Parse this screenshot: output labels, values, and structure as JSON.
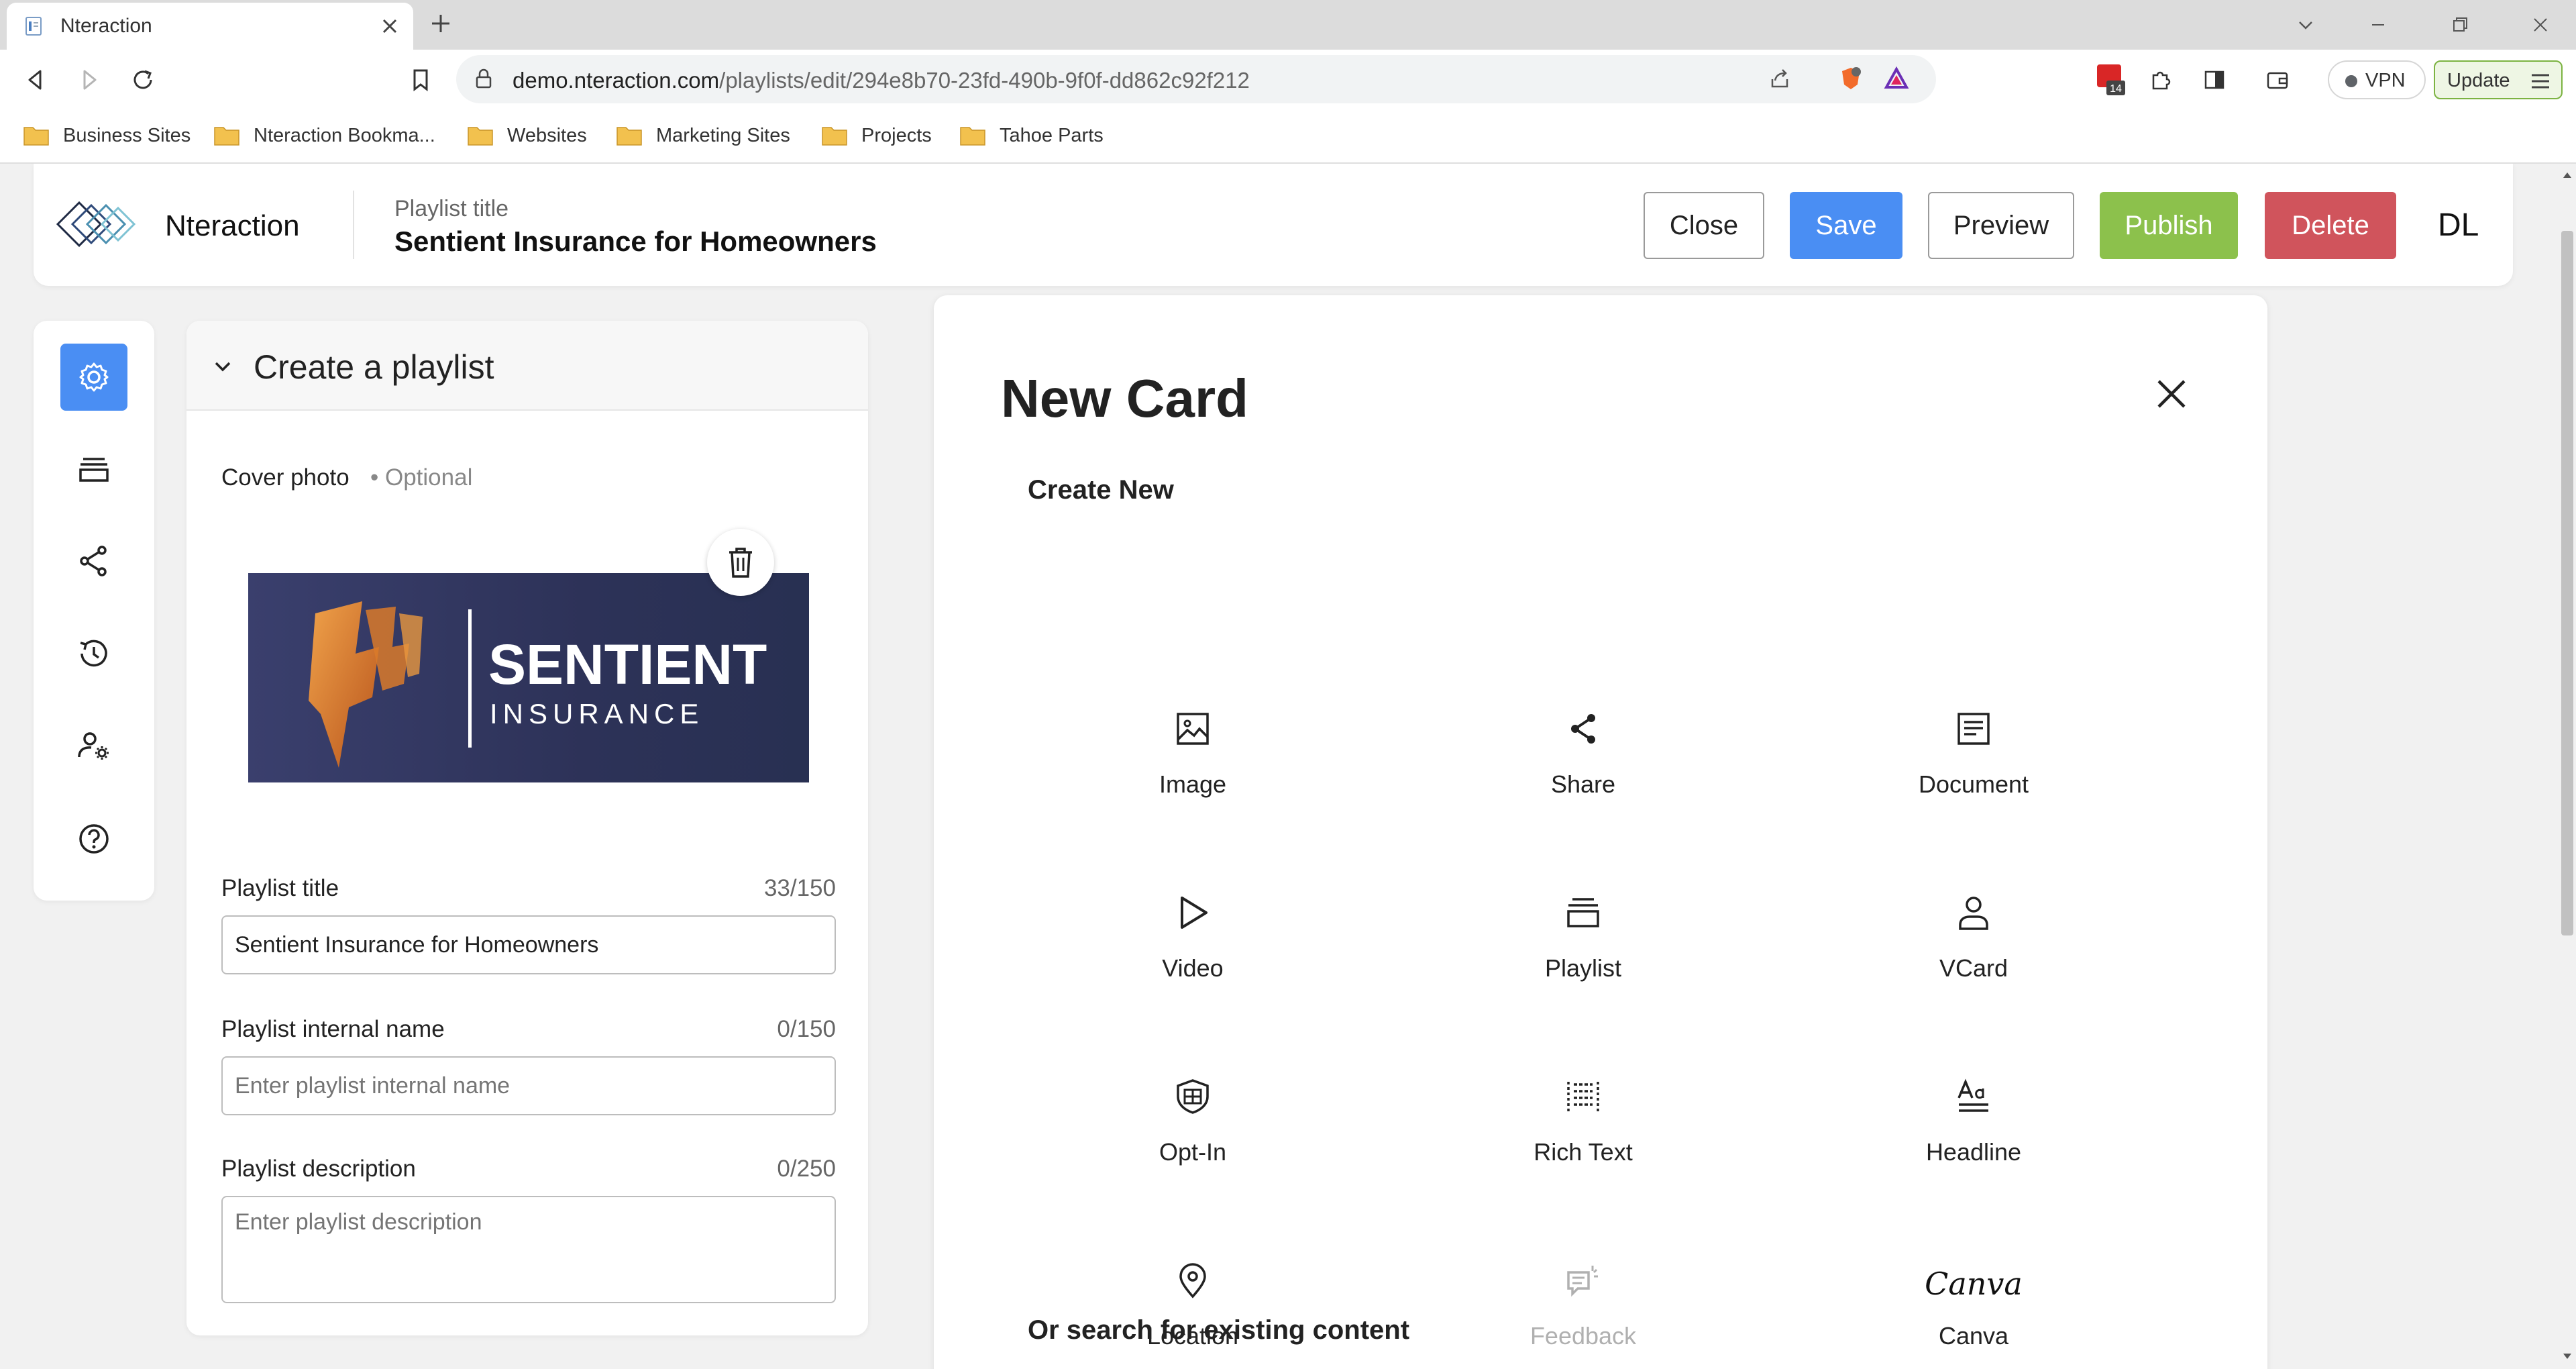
{
  "browser": {
    "tab_title": "Nteraction",
    "url_host": "demo.nteraction.com",
    "url_path": "/playlists/edit/294e8b70-23fd-490b-9f0f-dd862c92f212",
    "extension_badge": "14",
    "vpn_label": "VPN",
    "update_label": "Update",
    "bookmarks": [
      "Business Sites",
      "Nteraction Bookma...",
      "Websites",
      "Marketing Sites",
      "Projects",
      "Tahoe Parts"
    ]
  },
  "header": {
    "brand": "Nteraction",
    "title_label": "Playlist title",
    "title": "Sentient Insurance for Homeowners",
    "buttons": {
      "close": "Close",
      "save": "Save",
      "preview": "Preview",
      "publish": "Publish",
      "delete": "Delete"
    },
    "user_initials": "DL"
  },
  "rail": {
    "items": [
      "settings",
      "playlist",
      "share",
      "history",
      "user-settings",
      "help"
    ]
  },
  "panel": {
    "title": "Create a playlist",
    "cover_label": "Cover photo",
    "cover_optional": "• Optional",
    "cover_brand_name": "SENTIENT",
    "cover_brand_sub": "INSURANCE",
    "fields": {
      "title": {
        "label": "Playlist title",
        "count": "33/150",
        "value": "Sentient Insurance for Homeowners"
      },
      "internal_name": {
        "label": "Playlist internal name",
        "count": "0/150",
        "placeholder": "Enter playlist internal name"
      },
      "description": {
        "label": "Playlist description",
        "count": "0/250",
        "placeholder": "Enter playlist description"
      }
    }
  },
  "modal": {
    "title": "New Card",
    "create_new": "Create New",
    "options": [
      {
        "label": "Image",
        "icon": "image-icon"
      },
      {
        "label": "Share",
        "icon": "share-icon"
      },
      {
        "label": "Document",
        "icon": "document-icon"
      },
      {
        "label": "Video",
        "icon": "play-icon"
      },
      {
        "label": "Playlist",
        "icon": "playlist-icon"
      },
      {
        "label": "VCard",
        "icon": "person-icon"
      },
      {
        "label": "Opt-In",
        "icon": "opt-in-icon"
      },
      {
        "label": "Rich Text",
        "icon": "rich-text-icon"
      },
      {
        "label": "Headline",
        "icon": "headline-icon"
      },
      {
        "label": "Location",
        "icon": "location-pin-icon"
      },
      {
        "label": "Feedback",
        "icon": "feedback-icon",
        "disabled": true
      },
      {
        "label": "Canva",
        "icon": "canva-logo",
        "logo_text": "Canva"
      }
    ],
    "search_heading": "Or search for existing content"
  }
}
